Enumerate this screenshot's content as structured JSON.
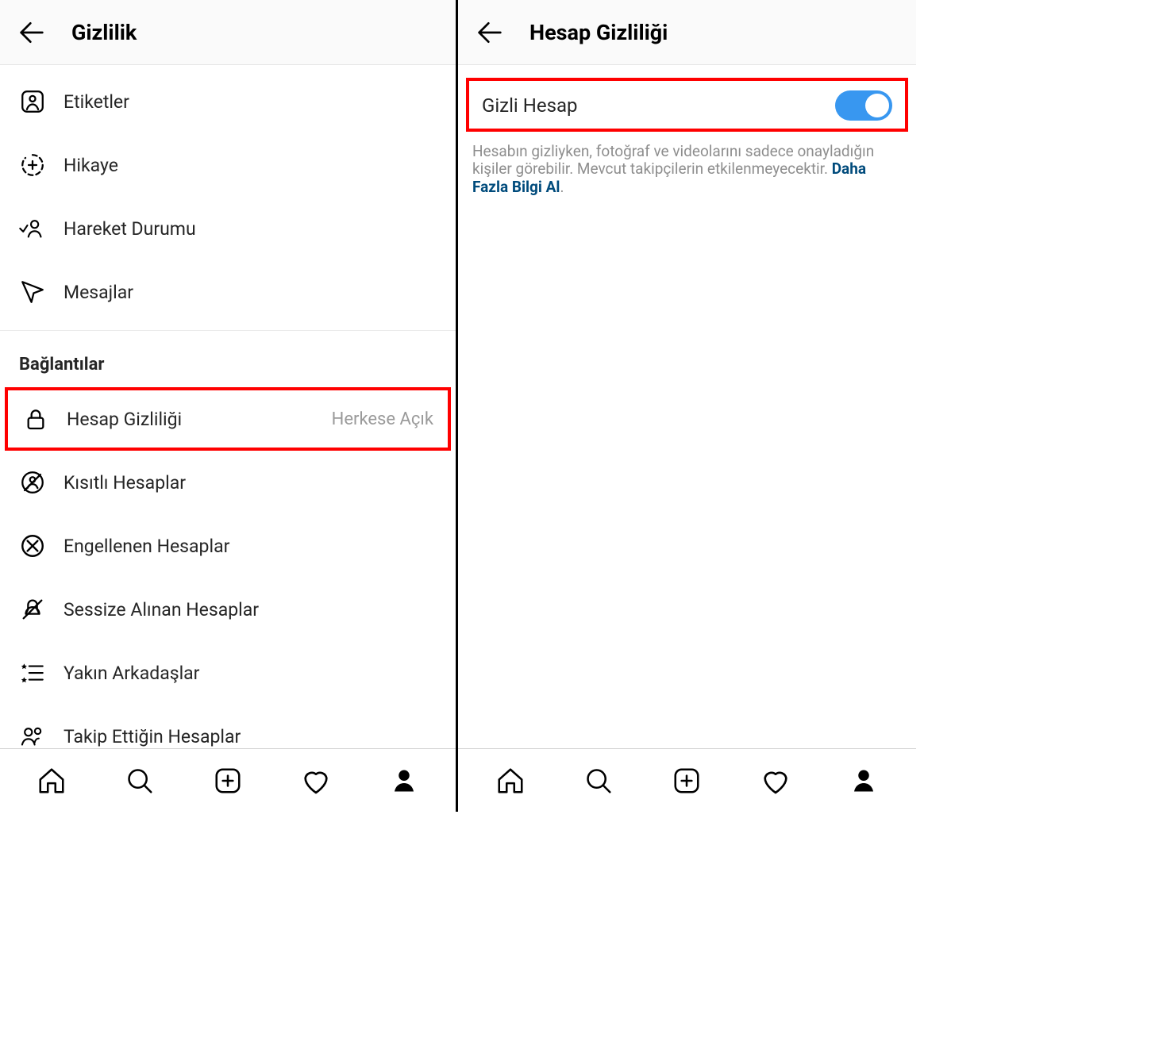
{
  "left": {
    "header_title": "Gizlilik",
    "items_top": [
      {
        "icon": "tags",
        "label": "Etiketler"
      },
      {
        "icon": "story",
        "label": "Hikaye"
      },
      {
        "icon": "activity",
        "label": "Hareket Durumu"
      },
      {
        "icon": "messages",
        "label": "Mesajlar"
      }
    ],
    "section_label": "Bağlantılar",
    "items_conn": [
      {
        "icon": "lock",
        "label": "Hesap Gizliliği",
        "value": "Herkese Açık",
        "highlight": true
      },
      {
        "icon": "restricted",
        "label": "Kısıtlı Hesaplar"
      },
      {
        "icon": "blocked",
        "label": "Engellenen Hesaplar"
      },
      {
        "icon": "muted",
        "label": "Sessize Alınan Hesaplar"
      },
      {
        "icon": "closefriends",
        "label": "Yakın Arkadaşlar"
      },
      {
        "icon": "following",
        "label": "Takip Ettiğin Hesaplar"
      }
    ]
  },
  "right": {
    "header_title": "Hesap Gizliliği",
    "toggle_label": "Gizli Hesap",
    "toggle_on": true,
    "desc_text": "Hesabın gizliyken, fotoğraf ve videolarını sadece onayladığın kişiler görebilir. Mevcut takipçilerin etkilenmeyecektir. ",
    "desc_link": "Daha Fazla Bilgi Al",
    "desc_suffix": "."
  }
}
